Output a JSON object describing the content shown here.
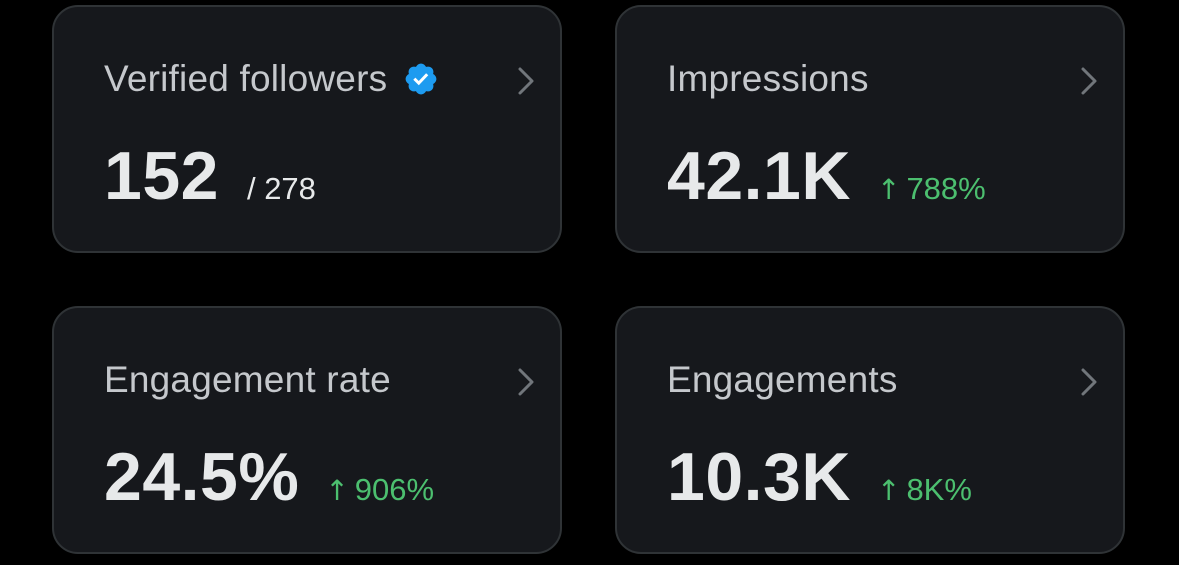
{
  "cards": [
    {
      "label": "Verified followers",
      "value": "152",
      "total": "/ 278",
      "icon": "verified-badge-icon"
    },
    {
      "label": "Impressions",
      "value": "42.1K",
      "delta": "788%",
      "delta_arrow": "↑"
    },
    {
      "label": "Engagement rate",
      "value": "24.5%",
      "delta": "906%",
      "delta_arrow": "↑"
    },
    {
      "label": "Engagements",
      "value": "10.3K",
      "delta": "8K%",
      "delta_arrow": "↑"
    }
  ],
  "colors": {
    "background": "#000000",
    "card": "#16181c",
    "card_border": "#2f3336",
    "label": "#c5c8cc",
    "value": "#e7e9ea",
    "positive": "#4cbf6f",
    "verified": "#1d9bf0",
    "chevron": "#71767b"
  }
}
